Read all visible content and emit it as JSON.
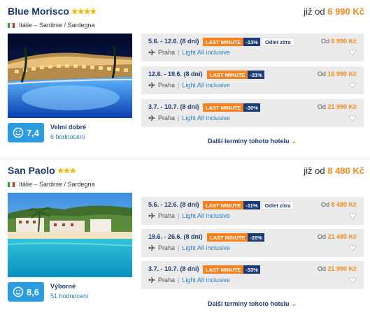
{
  "hotels": [
    {
      "name": "Blue Morisco",
      "stars": "★★★★",
      "price_prefix": "již od",
      "price": "6 990 Kč",
      "location": "Itálie – Sardinie / Sardegna",
      "rating": "7,4",
      "rating_text": "Velmi dobré",
      "reviews": "6 hodnocení",
      "terms": [
        {
          "dates": "5.6. - 12.6. (8 dní)",
          "badge": "LAST MINUTE",
          "discount": "-13%",
          "extra": "Odlet zítra",
          "from": "Praha",
          "board": "Light All inclusive",
          "price_prefix": "Od",
          "price": "6 990 Kč"
        },
        {
          "dates": "12.6. - 19.6. (8 dní)",
          "badge": "LAST MINUTE",
          "discount": "-31%",
          "extra": "",
          "from": "Praha",
          "board": "Light All inclusive",
          "price_prefix": "Od",
          "price": "16 990 Kč"
        },
        {
          "dates": "3.7. - 10.7. (8 dní)",
          "badge": "LAST MINUTE",
          "discount": "-30%",
          "extra": "",
          "from": "Praha",
          "board": "Light All inclusive",
          "price_prefix": "Od",
          "price": "21 990 Kč"
        }
      ],
      "more_label": "Další terminy tohoto hotelu"
    },
    {
      "name": "San Paolo",
      "stars": "★★★",
      "price_prefix": "již od",
      "price": "8 480 Kč",
      "location": "Itálie – Sardinie / Sardegna",
      "rating": "8,6",
      "rating_text": "Výborné",
      "reviews": "51 hodnocení",
      "terms": [
        {
          "dates": "5.6. - 12.6. (8 dní)",
          "badge": "LAST MINUTE",
          "discount": "-11%",
          "extra": "Odlet zítra",
          "from": "Praha",
          "board": "Light All inclusive",
          "price_prefix": "Od",
          "price": "8 480 Kč"
        },
        {
          "dates": "19.6. - 26.6. (8 dní)",
          "badge": "LAST MINUTE",
          "discount": "-20%",
          "extra": "",
          "from": "Praha",
          "board": "Light All inclusive",
          "price_prefix": "Od",
          "price": "21 480 Kč"
        },
        {
          "dates": "3.7. - 10.7. (8 dní)",
          "badge": "LAST MINUTE",
          "discount": "-33%",
          "extra": "",
          "from": "Praha",
          "board": "Light All inclusive",
          "price_prefix": "Od",
          "price": "21 990 Kč"
        }
      ],
      "more_label": "Další terminy tohoto hotelu"
    }
  ],
  "colors": {
    "accent": "#f58220",
    "navy": "#1a3b74",
    "rating_blue": "#2b9ce0",
    "price_orange": "#f08b1c"
  },
  "icons": {
    "flag": "italy-flag-icon",
    "plane": "plane-icon",
    "heart": "heart-icon",
    "smile": "smiley-icon",
    "chevron": "chevron-down-icon"
  }
}
